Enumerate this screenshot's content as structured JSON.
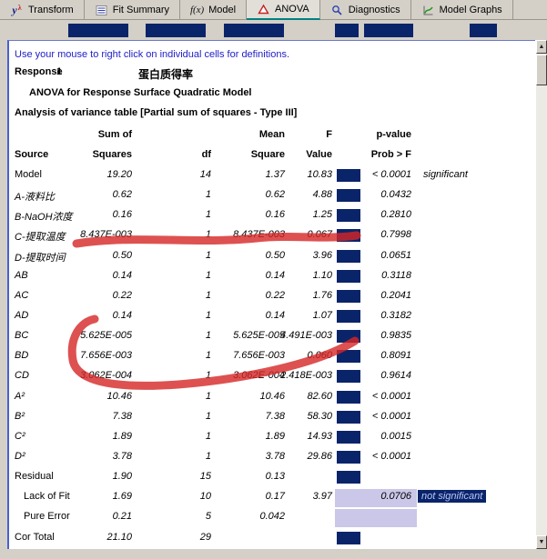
{
  "colors": {
    "window_gray": "#d4d0c8",
    "selection_navy": "#0a246a",
    "highlight_lavender": "#cac7e8",
    "marker_red": "#d62626",
    "hint_blue": "#2020c8",
    "active_tab_teal": "#008080"
  },
  "toolbar": {
    "transform_icon_main": "y",
    "transform_icon_sup": "λ",
    "model_icon_text": "f(x)",
    "tabs": [
      {
        "label": "Transform",
        "icon": "y-lambda-icon"
      },
      {
        "label": "Fit Summary",
        "icon": "list-icon"
      },
      {
        "label": "Model",
        "icon": "fx-icon"
      },
      {
        "label": "ANOVA",
        "icon": "triangle-icon",
        "active": true
      },
      {
        "label": "Diagnostics",
        "icon": "magnifier-icon"
      },
      {
        "label": "Model Graphs",
        "icon": "graph-icon"
      }
    ]
  },
  "report": {
    "hint": "Use your mouse to right click on individual cells for definitions.",
    "response_label": "Response",
    "response_number": "1",
    "response_name": "蛋白质得率",
    "subtitle": "ANOVA for Response Surface Quadratic Model",
    "table_title": "Analysis of variance table [Partial sum of squares - Type III]",
    "headers": {
      "row1": {
        "ss": "Sum of",
        "ms": "Mean",
        "f": "F",
        "p": "p-value"
      },
      "row2": {
        "source": "Source",
        "ss": "Squares",
        "df": "df",
        "ms": "Square",
        "f": "Value",
        "p": "Prob > F"
      }
    },
    "rows": [
      {
        "source": "Model",
        "ss": "19.20",
        "df": "14",
        "ms": "1.37",
        "f": "10.83",
        "p": "< 0.0001",
        "note": "significant",
        "italic": false,
        "navybox": true
      },
      {
        "source": "A-液料比",
        "ss": "0.62",
        "df": "1",
        "ms": "0.62",
        "f": "4.88",
        "p": "0.0432",
        "italic": true,
        "navybox": true
      },
      {
        "source": "B-NaOH浓度",
        "ss": "0.16",
        "df": "1",
        "ms": "0.16",
        "f": "1.25",
        "p": "0.2810",
        "italic": true,
        "navybox": true
      },
      {
        "source": "C-提取温度",
        "ss": "8.437E-003",
        "df": "1",
        "ms": "8.437E-003",
        "f": "0.067",
        "p": "0.7998",
        "italic": true,
        "navybox": true
      },
      {
        "source": "D-提取时间",
        "ss": "0.50",
        "df": "1",
        "ms": "0.50",
        "f": "3.96",
        "p": "0.0651",
        "italic": true,
        "navybox": true
      },
      {
        "source": "AB",
        "ss": "0.14",
        "df": "1",
        "ms": "0.14",
        "f": "1.10",
        "p": "0.3118",
        "italic": true,
        "navybox": true
      },
      {
        "source": "AC",
        "ss": "0.22",
        "df": "1",
        "ms": "0.22",
        "f": "1.76",
        "p": "0.2041",
        "italic": true,
        "navybox": true
      },
      {
        "source": "AD",
        "ss": "0.14",
        "df": "1",
        "ms": "0.14",
        "f": "1.07",
        "p": "0.3182",
        "italic": true,
        "navybox": true
      },
      {
        "source": "BC",
        "ss": "5.625E-005",
        "df": "1",
        "ms": "5.625E-005",
        "f": "4.491E-003",
        "p": "0.9835",
        "italic": true,
        "navybox": true
      },
      {
        "source": "BD",
        "ss": "7.656E-003",
        "df": "1",
        "ms": "7.656E-003",
        "f": "0.060",
        "p": "0.8091",
        "italic": true,
        "navybox": true
      },
      {
        "source": "CD",
        "ss": "3.062E-004",
        "df": "1",
        "ms": "3.062E-004",
        "f": "2.418E-003",
        "p": "0.9614",
        "italic": true,
        "navybox": true
      },
      {
        "source": "A²",
        "ss": "10.46",
        "df": "1",
        "ms": "10.46",
        "f": "82.60",
        "p": "< 0.0001",
        "italic": true,
        "navybox": true
      },
      {
        "source": "B²",
        "ss": "7.38",
        "df": "1",
        "ms": "7.38",
        "f": "58.30",
        "p": "< 0.0001",
        "italic": true,
        "navybox": true
      },
      {
        "source": "C²",
        "ss": "1.89",
        "df": "1",
        "ms": "1.89",
        "f": "14.93",
        "p": "0.0015",
        "italic": true,
        "navybox": true
      },
      {
        "source": "D²",
        "ss": "3.78",
        "df": "1",
        "ms": "3.78",
        "f": "29.86",
        "p": "< 0.0001",
        "italic": true,
        "navybox": true
      },
      {
        "source": "Residual",
        "ss": "1.90",
        "df": "15",
        "ms": "0.13",
        "italic": false,
        "navybox": true
      },
      {
        "source": "Lack of Fit",
        "ss": "1.69",
        "df": "10",
        "ms": "0.17",
        "f": "3.97",
        "p": "0.0706",
        "note": "not significant",
        "italic": false,
        "indent": true,
        "p_highlight": true,
        "note_highlight": true,
        "navybox": false
      },
      {
        "source": "Pure Error",
        "ss": "0.21",
        "df": "5",
        "ms": "0.042",
        "italic": false,
        "indent": true,
        "p_highlight": true,
        "navybox": false
      },
      {
        "source": "Cor Total",
        "ss": "21.10",
        "df": "29",
        "italic": false,
        "navybox": true
      }
    ]
  }
}
